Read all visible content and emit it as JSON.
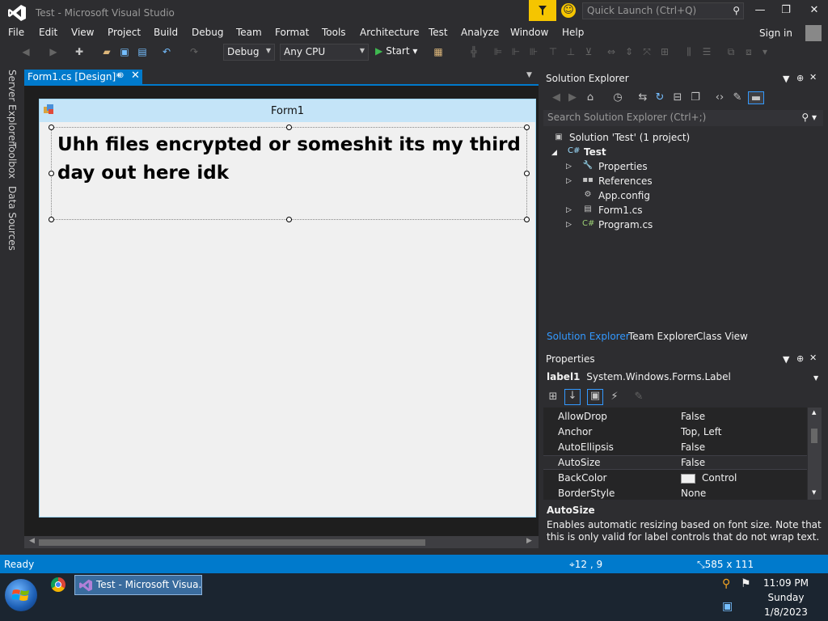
{
  "window": {
    "title": "Test - Microsoft Visual Studio",
    "quick_launch_placeholder": "Quick Launch (Ctrl+Q)",
    "min": "—",
    "max": "❐",
    "close": "✕"
  },
  "menu": {
    "items": [
      "File",
      "Edit",
      "View",
      "Project",
      "Build",
      "Debug",
      "Team",
      "Format",
      "Tools",
      "Architecture",
      "Test",
      "Analyze",
      "Window",
      "Help"
    ],
    "sign_in": "Sign in"
  },
  "toolbar": {
    "config": "Debug",
    "platform": "Any CPU",
    "start": "Start"
  },
  "side_tabs": [
    "Server Explorer",
    "Toolbox",
    "Data Sources"
  ],
  "document": {
    "tab_label": "Form1.cs [Design]*",
    "form_title": "Form1",
    "label_text": "Uhh files encrypted or someshit its my third day out here idk"
  },
  "solution_explorer": {
    "title": "Solution Explorer",
    "search_placeholder": "Search Solution Explorer (Ctrl+;)",
    "tree": [
      {
        "label": "Solution 'Test' (1 project)",
        "icon": "solution-icon"
      },
      {
        "label": "Test",
        "icon": "csharp-project-icon"
      },
      {
        "label": "Properties",
        "icon": "wrench-icon"
      },
      {
        "label": "References",
        "icon": "references-icon"
      },
      {
        "label": "App.config",
        "icon": "config-file-icon"
      },
      {
        "label": "Form1.cs",
        "icon": "form-file-icon"
      },
      {
        "label": "Program.cs",
        "icon": "csharp-file-icon"
      }
    ],
    "tabs": [
      "Solution Explorer",
      "Team Explorer",
      "Class View"
    ]
  },
  "properties": {
    "title": "Properties",
    "object_name": "label1",
    "object_type": "System.Windows.Forms.Label",
    "rows": [
      {
        "name": "AllowDrop",
        "value": "False"
      },
      {
        "name": "Anchor",
        "value": "Top, Left"
      },
      {
        "name": "AutoEllipsis",
        "value": "False"
      },
      {
        "name": "AutoSize",
        "value": "False"
      },
      {
        "name": "BackColor",
        "value": "Control"
      },
      {
        "name": "BorderStyle",
        "value": "None"
      }
    ],
    "description_title": "AutoSize",
    "description_text": "Enables automatic resizing based on font size. Note that this is only valid for label controls that do not wrap text."
  },
  "status": {
    "ready": "Ready",
    "position": "12 , 9",
    "size": "585 x 111"
  },
  "taskbar": {
    "active_item": "Test - Microsoft Visua...",
    "time": "11:09 PM",
    "day": "Sunday",
    "date": "1/8/2023"
  }
}
